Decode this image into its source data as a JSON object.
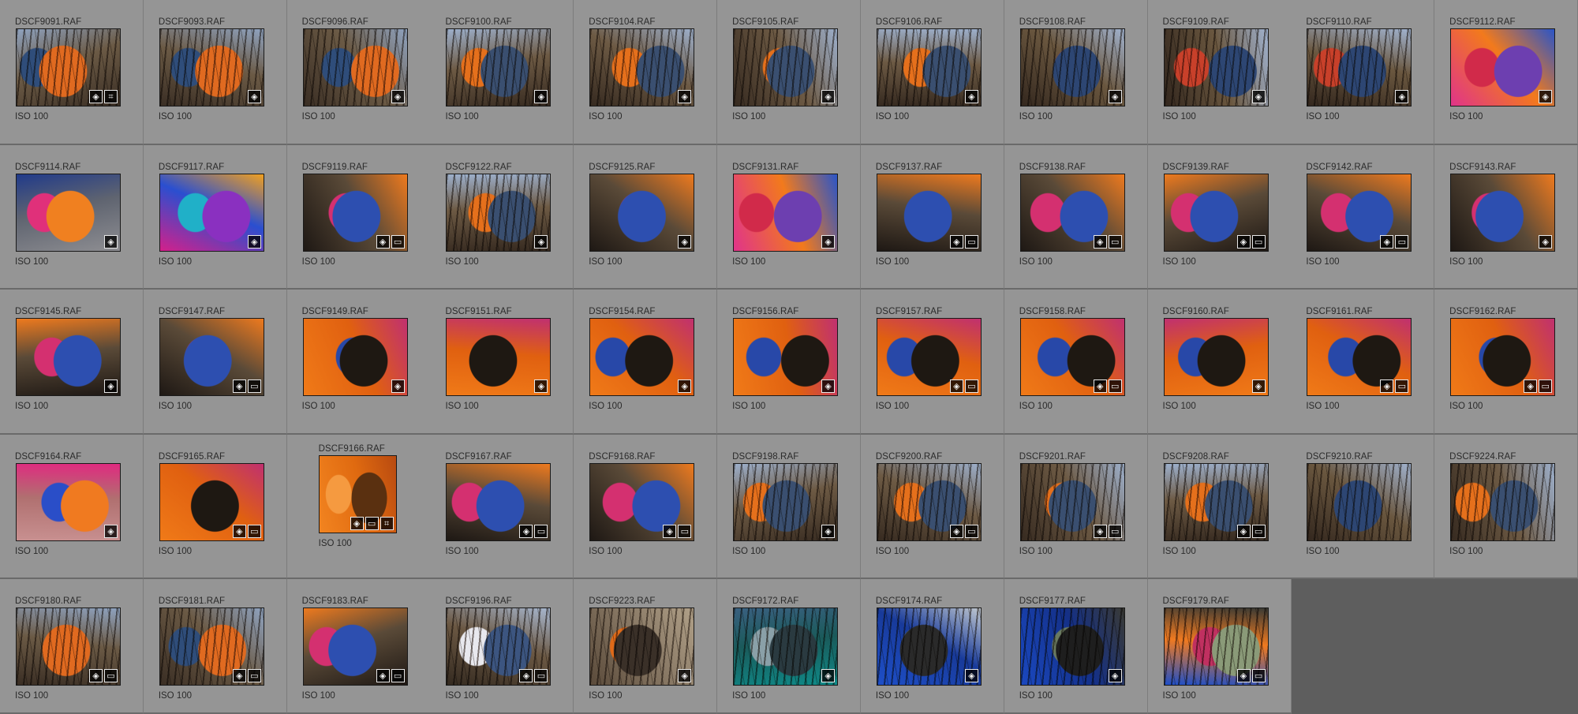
{
  "grid": {
    "columns": 11,
    "iso_label": "ISO 100",
    "empty_area_color": "#5e5e5e",
    "cell_color": "#959595",
    "items": [
      {
        "name": "DSCF9091.RAF",
        "iso": "ISO 100",
        "scene": "forest-clothes",
        "badges": [
          "edit",
          "crop"
        ]
      },
      {
        "name": "DSCF9093.RAF",
        "iso": "ISO 100",
        "scene": "forest-clothes",
        "badges": [
          "edit"
        ]
      },
      {
        "name": "DSCF9096.RAF",
        "iso": "ISO 100",
        "scene": "forest-clothes",
        "badges": [
          "edit"
        ]
      },
      {
        "name": "DSCF9100.RAF",
        "iso": "ISO 100",
        "scene": "forest-orange",
        "badges": [
          "edit"
        ]
      },
      {
        "name": "DSCF9104.RAF",
        "iso": "ISO 100",
        "scene": "forest-orange",
        "badges": [
          "edit"
        ]
      },
      {
        "name": "DSCF9105.RAF",
        "iso": "ISO 100",
        "scene": "forest-orange",
        "badges": [
          "edit"
        ]
      },
      {
        "name": "DSCF9106.RAF",
        "iso": "ISO 100",
        "scene": "forest-orange",
        "badges": [
          "edit"
        ]
      },
      {
        "name": "DSCF9108.RAF",
        "iso": "ISO 100",
        "scene": "forest-red",
        "badges": [
          "edit"
        ]
      },
      {
        "name": "DSCF9109.RAF",
        "iso": "ISO 100",
        "scene": "forest-red",
        "badges": [
          "edit"
        ]
      },
      {
        "name": "DSCF9110.RAF",
        "iso": "ISO 100",
        "scene": "forest-red",
        "badges": [
          "edit"
        ]
      },
      {
        "name": "DSCF9112.RAF",
        "iso": "ISO 100",
        "scene": "colorful-closeup",
        "badges": [
          "edit"
        ]
      },
      {
        "name": "DSCF9114.RAF",
        "iso": "ISO 100",
        "scene": "colorful-gray",
        "badges": [
          "edit"
        ]
      },
      {
        "name": "DSCF9117.RAF",
        "iso": "ISO 100",
        "scene": "psychedelic",
        "badges": [
          "edit"
        ]
      },
      {
        "name": "DSCF9119.RAF",
        "iso": "ISO 100",
        "scene": "orange-robe",
        "badges": [
          "edit",
          "copy"
        ]
      },
      {
        "name": "DSCF9122.RAF",
        "iso": "ISO 100",
        "scene": "forest-orange",
        "badges": [
          "edit"
        ]
      },
      {
        "name": "DSCF9125.RAF",
        "iso": "ISO 100",
        "scene": "orange-robe",
        "badges": [
          "edit"
        ]
      },
      {
        "name": "DSCF9131.RAF",
        "iso": "ISO 100",
        "scene": "colorful-closeup",
        "badges": [
          "edit"
        ]
      },
      {
        "name": "DSCF9137.RAF",
        "iso": "ISO 100",
        "scene": "orange-robe",
        "badges": [
          "edit",
          "copy"
        ]
      },
      {
        "name": "DSCF9138.RAF",
        "iso": "ISO 100",
        "scene": "orange-robe",
        "badges": [
          "edit",
          "copy"
        ]
      },
      {
        "name": "DSCF9139.RAF",
        "iso": "ISO 100",
        "scene": "orange-robe",
        "badges": [
          "edit",
          "copy"
        ]
      },
      {
        "name": "DSCF9142.RAF",
        "iso": "ISO 100",
        "scene": "orange-robe",
        "badges": [
          "edit",
          "copy"
        ]
      },
      {
        "name": "DSCF9143.RAF",
        "iso": "ISO 100",
        "scene": "orange-robe",
        "badges": [
          "edit"
        ]
      },
      {
        "name": "DSCF9145.RAF",
        "iso": "ISO 100",
        "scene": "orange-robe",
        "badges": [
          "edit"
        ]
      },
      {
        "name": "DSCF9147.RAF",
        "iso": "ISO 100",
        "scene": "orange-robe",
        "badges": [
          "edit",
          "copy"
        ]
      },
      {
        "name": "DSCF9149.RAF",
        "iso": "ISO 100",
        "scene": "orange-closeup",
        "badges": [
          "edit"
        ]
      },
      {
        "name": "DSCF9151.RAF",
        "iso": "ISO 100",
        "scene": "orange-closeup",
        "badges": [
          "edit"
        ]
      },
      {
        "name": "DSCF9154.RAF",
        "iso": "ISO 100",
        "scene": "orange-closeup",
        "badges": [
          "edit"
        ]
      },
      {
        "name": "DSCF9156.RAF",
        "iso": "ISO 100",
        "scene": "orange-closeup",
        "badges": [
          "edit"
        ]
      },
      {
        "name": "DSCF9157.RAF",
        "iso": "ISO 100",
        "scene": "orange-closeup",
        "badges": [
          "edit",
          "copy"
        ]
      },
      {
        "name": "DSCF9158.RAF",
        "iso": "ISO 100",
        "scene": "orange-closeup",
        "badges": [
          "edit",
          "copy"
        ]
      },
      {
        "name": "DSCF9160.RAF",
        "iso": "ISO 100",
        "scene": "orange-closeup",
        "badges": [
          "edit"
        ]
      },
      {
        "name": "DSCF9161.RAF",
        "iso": "ISO 100",
        "scene": "orange-closeup",
        "badges": [
          "edit",
          "copy"
        ]
      },
      {
        "name": "DSCF9162.RAF",
        "iso": "ISO 100",
        "scene": "orange-closeup",
        "badges": [
          "edit",
          "copy"
        ]
      },
      {
        "name": "DSCF9164.RAF",
        "iso": "ISO 100",
        "scene": "pink-closeup",
        "badges": [
          "edit"
        ]
      },
      {
        "name": "DSCF9165.RAF",
        "iso": "ISO 100",
        "scene": "orange-closeup",
        "badges": [
          "edit",
          "copy"
        ]
      },
      {
        "name": "DSCF9166.RAF",
        "iso": "ISO 100",
        "scene": "orange-portrait",
        "badges": [
          "edit",
          "copy",
          "crop"
        ],
        "portrait": true
      },
      {
        "name": "DSCF9167.RAF",
        "iso": "ISO 100",
        "scene": "orange-robe",
        "badges": [
          "edit",
          "copy"
        ]
      },
      {
        "name": "DSCF9168.RAF",
        "iso": "ISO 100",
        "scene": "orange-robe",
        "badges": [
          "edit",
          "copy"
        ]
      },
      {
        "name": "DSCF9198.RAF",
        "iso": "ISO 100",
        "scene": "forest-orange",
        "badges": [
          "edit"
        ]
      },
      {
        "name": "DSCF9200.RAF",
        "iso": "ISO 100",
        "scene": "forest-orange",
        "badges": [
          "edit",
          "copy"
        ]
      },
      {
        "name": "DSCF9201.RAF",
        "iso": "ISO 100",
        "scene": "forest-orange",
        "badges": [
          "edit",
          "copy"
        ]
      },
      {
        "name": "DSCF9208.RAF",
        "iso": "ISO 100",
        "scene": "forest-orange",
        "badges": [
          "edit",
          "copy"
        ]
      },
      {
        "name": "DSCF9210.RAF",
        "iso": "ISO 100",
        "scene": "forest-red",
        "badges": []
      },
      {
        "name": "DSCF9224.RAF",
        "iso": "ISO 100",
        "scene": "forest-orange",
        "badges": []
      },
      {
        "name": "DSCF9180.RAF",
        "iso": "ISO 100",
        "scene": "forest-clothes",
        "badges": [
          "edit",
          "copy"
        ]
      },
      {
        "name": "DSCF9181.RAF",
        "iso": "ISO 100",
        "scene": "forest-clothes",
        "badges": [
          "edit",
          "copy"
        ]
      },
      {
        "name": "DSCF9183.RAF",
        "iso": "ISO 100",
        "scene": "orange-robe",
        "badges": [
          "edit",
          "copy"
        ]
      },
      {
        "name": "DSCF9196.RAF",
        "iso": "ISO 100",
        "scene": "forest-white",
        "badges": [
          "edit",
          "copy"
        ]
      },
      {
        "name": "DSCF9223.RAF",
        "iso": "ISO 100",
        "scene": "blur-orange",
        "badges": [
          "edit"
        ]
      },
      {
        "name": "DSCF9172.RAF",
        "iso": "ISO 100",
        "scene": "teal",
        "badges": [
          "edit"
        ]
      },
      {
        "name": "DSCF9174.RAF",
        "iso": "ISO 100",
        "scene": "blue-robe",
        "badges": [
          "edit"
        ]
      },
      {
        "name": "DSCF9177.RAF",
        "iso": "ISO 100",
        "scene": "blue-robe-dark",
        "badges": [
          "edit"
        ]
      },
      {
        "name": "DSCF9179.RAF",
        "iso": "ISO 100",
        "scene": "blue-orange",
        "badges": [
          "edit",
          "copy"
        ]
      }
    ]
  },
  "badge_icons": {
    "edit": "◈",
    "copy": "▭",
    "crop": "⌗"
  },
  "scenes": {
    "forest-clothes": [
      "#3a2e24",
      "#6b5a45",
      "#8fa3c0",
      "#2f4d7a",
      "#e06a20"
    ],
    "forest-orange": [
      "#362a20",
      "#6d5a44",
      "#9db0cc",
      "#e5701c",
      "#3a4f70"
    ],
    "forest-red": [
      "#33271e",
      "#6a573f",
      "#a1b3cf",
      "#c8402a",
      "#2d4673"
    ],
    "forest-white": [
      "#342a20",
      "#6b5843",
      "#a8b8d0",
      "#e8e8ee",
      "#3c5580"
    ],
    "colorful-closeup": [
      "#e0348a",
      "#f27a1c",
      "#2a55c8",
      "#d12a4a",
      "#6d3fb0"
    ],
    "colorful-gray": [
      "#8e8e92",
      "#5f6470",
      "#203a8a",
      "#e0307a",
      "#f08020"
    ],
    "psychedelic": [
      "#d4208a",
      "#2a4fd0",
      "#f0a020",
      "#20b0c8",
      "#8a30c0"
    ],
    "orange-robe": [
      "#1e1814",
      "#5a4a38",
      "#ee7a1e",
      "#d43070",
      "#2d4fb0"
    ],
    "orange-closeup": [
      "#f07a18",
      "#e06010",
      "#c03070",
      "#2848a8",
      "#1e1812"
    ],
    "orange-portrait": [
      "#f28420",
      "#e06a10",
      "#b84a10",
      "#f59a40",
      "#5a3010"
    ],
    "pink-closeup": [
      "#c89090",
      "#b07070",
      "#e02a80",
      "#2a4ec8",
      "#f07a20"
    ],
    "blur-orange": [
      "#5a4a3a",
      "#8a7a66",
      "#b0a088",
      "#e06a18",
      "#3a3028"
    ],
    "teal": [
      "#0f8a88",
      "#1a5a5a",
      "#3a6080",
      "#8aa0a8",
      "#2a3a40"
    ],
    "blue-robe": [
      "#1e4fc8",
      "#183a9a",
      "#c0c8d0",
      "#8a9a78",
      "#2a2a2a"
    ],
    "blue-robe-dark": [
      "#1a48c0",
      "#143088",
      "#3a3a34",
      "#6a7a60",
      "#1e1e1e"
    ],
    "blue-orange": [
      "#1e4fc8",
      "#f07a20",
      "#3a3a34",
      "#c03060",
      "#8a9a78"
    ]
  }
}
